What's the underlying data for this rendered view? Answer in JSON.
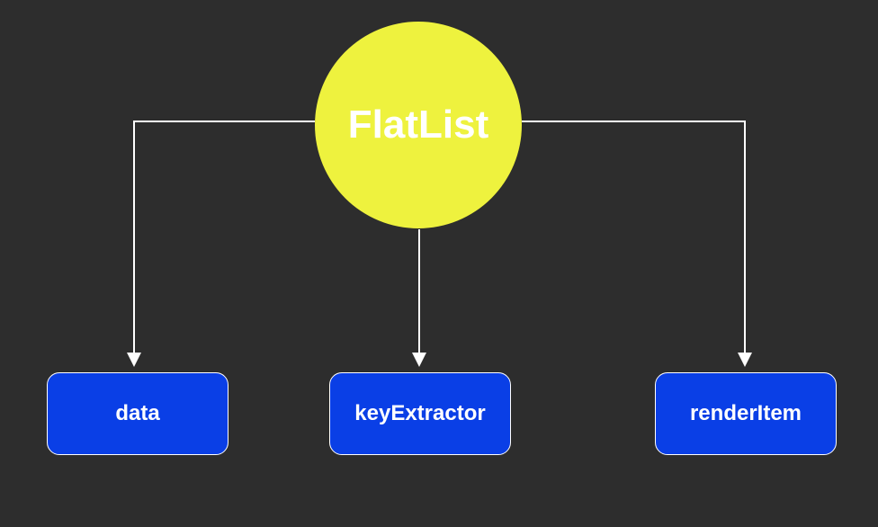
{
  "root": {
    "label": "FlatList",
    "shape": "circle",
    "color": "#eef23e",
    "text_color": "#ffffff"
  },
  "children": [
    {
      "id": "data",
      "label": "data",
      "shape": "rounded-rect",
      "color": "#0a3fe6",
      "text_color": "#ffffff"
    },
    {
      "id": "keyExtractor",
      "label": "keyExtractor",
      "shape": "rounded-rect",
      "color": "#0a3fe6",
      "text_color": "#ffffff"
    },
    {
      "id": "renderItem",
      "label": "renderItem",
      "shape": "rounded-rect",
      "color": "#0a3fe6",
      "text_color": "#ffffff"
    }
  ],
  "edges": [
    {
      "from": "root",
      "to": "data"
    },
    {
      "from": "root",
      "to": "keyExtractor"
    },
    {
      "from": "root",
      "to": "renderItem"
    }
  ],
  "background": "#2d2d2d",
  "arrow_color": "#ffffff"
}
